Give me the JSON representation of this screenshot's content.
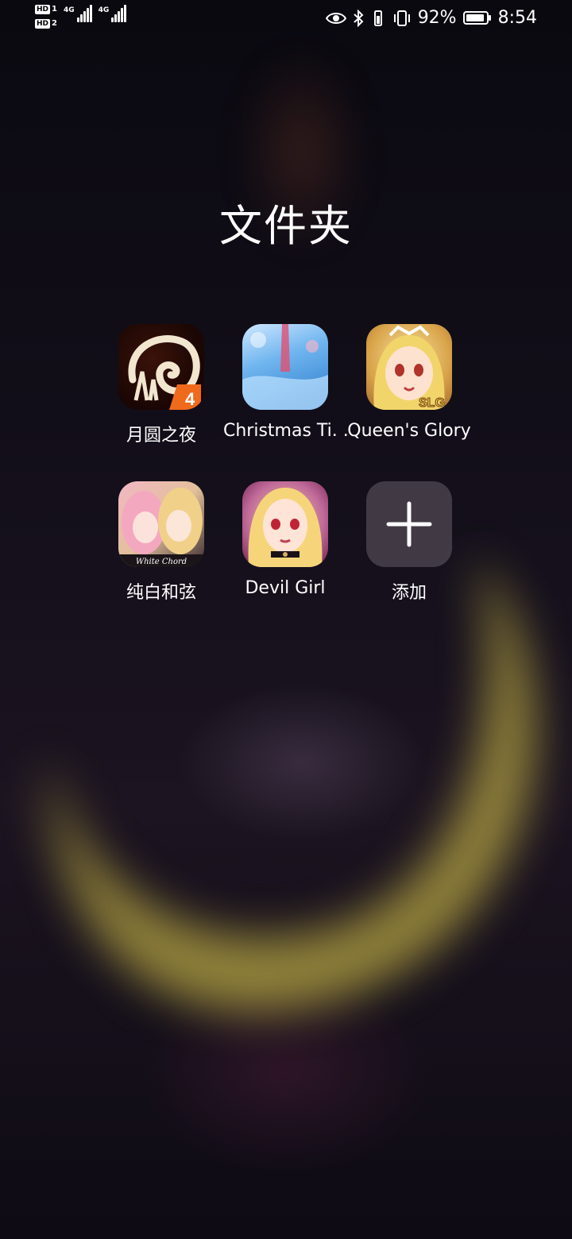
{
  "status_bar": {
    "sim1_badge": "HD",
    "sim1_num": "1",
    "sim2_badge": "HD",
    "sim2_num": "2",
    "net1": "4G",
    "net2": "4G",
    "battery_percent": "92%",
    "battery_level": 0.92,
    "time": "8:54",
    "icons": [
      "eye-icon",
      "bluetooth-icon",
      "vibrate-icon"
    ]
  },
  "folder": {
    "title": "文件夹",
    "apps": [
      {
        "label": "月圆之夜",
        "icon": "moon-night-app-icon"
      },
      {
        "label": "Christmas Ti. .",
        "icon": "christmas-app-icon"
      },
      {
        "label": "Queen's Glory",
        "icon": "queens-glory-app-icon"
      },
      {
        "label": "纯白和弦",
        "icon": "white-chord-app-icon"
      },
      {
        "label": "Devil Girl",
        "icon": "devil-girl-app-icon"
      },
      {
        "label": "添加",
        "icon": "plus-icon"
      }
    ]
  },
  "icon_text": {
    "white_chord_caption": "White Chord",
    "queen_badge": "SLG"
  }
}
